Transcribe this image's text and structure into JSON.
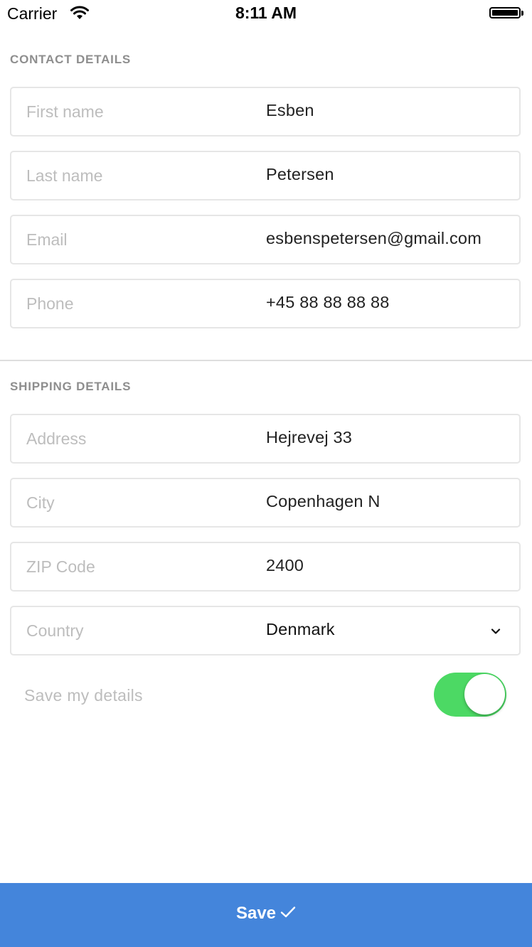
{
  "status_bar": {
    "carrier": "Carrier",
    "time": "8:11 AM"
  },
  "contact": {
    "title": "CONTACT DETAILS",
    "fields": [
      {
        "label": "First name",
        "value": "Esben"
      },
      {
        "label": "Last name",
        "value": "Petersen"
      },
      {
        "label": "Email",
        "value": "esbenspetersen@gmail.com"
      },
      {
        "label": "Phone",
        "value": "+45 88 88 88 88"
      }
    ]
  },
  "shipping": {
    "title": "SHIPPING DETAILS",
    "fields": [
      {
        "label": "Address",
        "value": "Hejrevej 33"
      },
      {
        "label": "City",
        "value": "Copenhagen N"
      },
      {
        "label": "ZIP Code",
        "value": "2400"
      },
      {
        "label": "Country",
        "value": "Denmark"
      }
    ]
  },
  "save_details": {
    "label": "Save my details",
    "enabled": true
  },
  "save_button": {
    "label": "Save"
  },
  "colors": {
    "accent": "#4485db",
    "toggle_on": "#4cd964"
  },
  "icons": [
    "wifi-icon",
    "battery-icon",
    "chevron-down-icon",
    "checkmark-icon"
  ]
}
